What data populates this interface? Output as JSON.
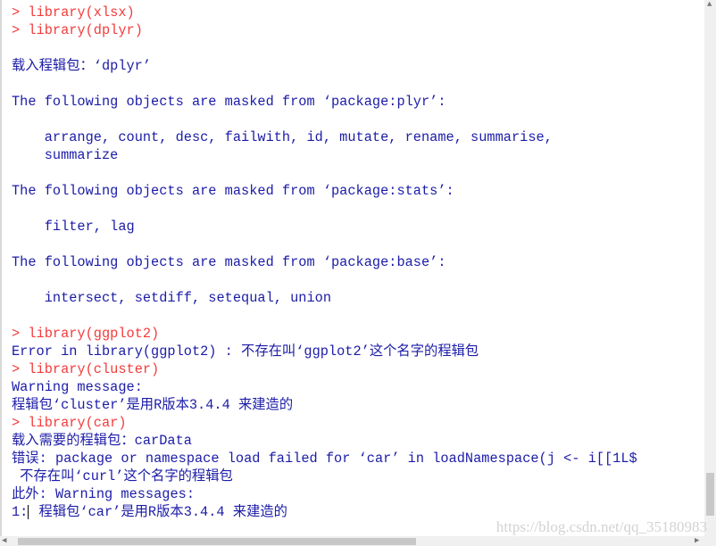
{
  "console": {
    "lines": [
      {
        "text": "> library(xlsx)",
        "type": "command"
      },
      {
        "text": "> library(dplyr)",
        "type": "command"
      },
      {
        "text": "",
        "type": "output"
      },
      {
        "text": "载入程辑包：‘dplyr’",
        "type": "output"
      },
      {
        "text": "",
        "type": "output"
      },
      {
        "text": "The following objects are masked from ‘package:plyr’:",
        "type": "output"
      },
      {
        "text": "",
        "type": "output"
      },
      {
        "text": "    arrange, count, desc, failwith, id, mutate, rename, summarise,",
        "type": "output"
      },
      {
        "text": "    summarize",
        "type": "output"
      },
      {
        "text": "",
        "type": "output"
      },
      {
        "text": "The following objects are masked from ‘package:stats’:",
        "type": "output"
      },
      {
        "text": "",
        "type": "output"
      },
      {
        "text": "    filter, lag",
        "type": "output"
      },
      {
        "text": "",
        "type": "output"
      },
      {
        "text": "The following objects are masked from ‘package:base’:",
        "type": "output"
      },
      {
        "text": "",
        "type": "output"
      },
      {
        "text": "    intersect, setdiff, setequal, union",
        "type": "output"
      },
      {
        "text": "",
        "type": "output"
      },
      {
        "text": "> library(ggplot2)",
        "type": "command"
      },
      {
        "text": "Error in library(ggplot2) : 不存在叫‘ggplot2’这个名字的程辑包",
        "type": "output"
      },
      {
        "text": "> library(cluster)",
        "type": "command"
      },
      {
        "text": "Warning message:",
        "type": "output"
      },
      {
        "text": "程辑包‘cluster’是用R版本3.4.4 来建造的",
        "type": "output"
      },
      {
        "text": "> library(car)",
        "type": "command"
      },
      {
        "text": "载入需要的程辑包：carData",
        "type": "output"
      },
      {
        "text": "错误: package or namespace load failed for ‘car’ in loadNamespace(j <- i[[1L$",
        "type": "output"
      },
      {
        "text": " 不存在叫‘curl’这个名字的程辑包",
        "type": "output"
      },
      {
        "text": "此外: Warning messages:",
        "type": "output"
      },
      {
        "text": " 程辑包‘car’是用R版本3.4.4 来建造的",
        "type": "output",
        "prefix": "1:",
        "cursor": true
      }
    ]
  },
  "watermark": "https://blog.csdn.net/qq_35180983",
  "colors": {
    "command": "#f43b3b",
    "output": "#1c1ca8"
  }
}
